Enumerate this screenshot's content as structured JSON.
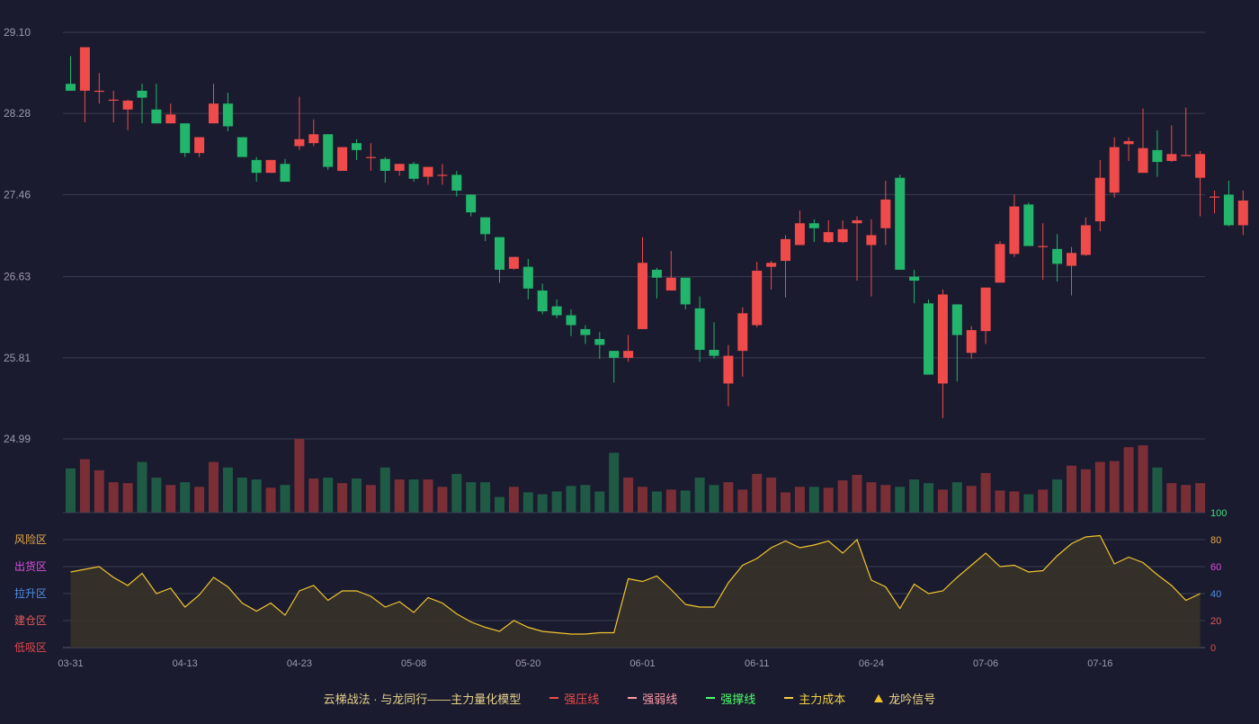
{
  "chart_data": {
    "type": "candlestick",
    "price_axis": {
      "ticks": [
        "29.10",
        "28.28",
        "27.46",
        "26.63",
        "25.81",
        "24.99"
      ],
      "ylim": [
        24.99,
        29.1
      ]
    },
    "x_axis": {
      "ticks": [
        {
          "label": "03-31",
          "index": 0
        },
        {
          "label": "04-13",
          "index": 8
        },
        {
          "label": "04-23",
          "index": 16
        },
        {
          "label": "05-08",
          "index": 24
        },
        {
          "label": "05-20",
          "index": 32
        },
        {
          "label": "06-01",
          "index": 40
        },
        {
          "label": "06-11",
          "index": 48
        },
        {
          "label": "06-24",
          "index": 56
        },
        {
          "label": "07-06",
          "index": 64
        },
        {
          "label": "07-16",
          "index": 72
        }
      ]
    },
    "ohlc": [
      [
        28.58,
        28.51,
        28.86,
        28.51
      ],
      [
        28.51,
        28.95,
        28.95,
        28.19
      ],
      [
        28.51,
        28.51,
        28.69,
        28.38
      ],
      [
        28.41,
        28.42,
        28.51,
        28.19
      ],
      [
        28.32,
        28.41,
        28.42,
        28.11
      ],
      [
        28.51,
        28.44,
        28.58,
        28.18
      ],
      [
        28.32,
        28.18,
        28.58,
        28.18
      ],
      [
        28.18,
        28.27,
        28.38,
        28.18
      ],
      [
        28.18,
        27.88,
        28.18,
        27.84
      ],
      [
        27.88,
        28.04,
        28.04,
        27.84
      ],
      [
        28.18,
        28.38,
        28.58,
        28.18
      ],
      [
        28.38,
        28.15,
        28.49,
        28.1
      ],
      [
        28.04,
        27.84,
        28.04,
        27.84
      ],
      [
        27.81,
        27.68,
        27.84,
        27.59
      ],
      [
        27.68,
        27.81,
        27.81,
        27.68
      ],
      [
        27.77,
        27.59,
        27.82,
        27.59
      ],
      [
        27.95,
        28.02,
        28.45,
        27.91
      ],
      [
        27.98,
        28.07,
        28.22,
        27.95
      ],
      [
        28.07,
        27.74,
        28.07,
        27.71
      ],
      [
        27.7,
        27.94,
        27.94,
        27.7
      ],
      [
        27.98,
        27.91,
        28.02,
        27.81
      ],
      [
        27.84,
        27.84,
        27.98,
        27.7
      ],
      [
        27.82,
        27.7,
        27.84,
        27.58
      ],
      [
        27.7,
        27.77,
        27.77,
        27.65
      ],
      [
        27.77,
        27.62,
        27.79,
        27.59
      ],
      [
        27.64,
        27.74,
        27.74,
        27.56
      ],
      [
        27.66,
        27.66,
        27.77,
        27.56
      ],
      [
        27.66,
        27.5,
        27.7,
        27.44
      ],
      [
        27.46,
        27.28,
        27.46,
        27.24
      ],
      [
        27.23,
        27.06,
        27.23,
        26.99
      ],
      [
        27.03,
        26.7,
        27.03,
        26.57
      ],
      [
        26.71,
        26.83,
        26.83,
        26.7
      ],
      [
        26.73,
        26.51,
        26.81,
        26.4
      ],
      [
        26.49,
        26.28,
        26.56,
        26.25
      ],
      [
        26.33,
        26.24,
        26.4,
        26.21
      ],
      [
        26.24,
        26.14,
        26.3,
        26.03
      ],
      [
        26.1,
        26.04,
        26.14,
        25.95
      ],
      [
        26.0,
        25.94,
        26.07,
        25.8
      ],
      [
        25.88,
        25.81,
        25.88,
        25.56
      ],
      [
        25.81,
        25.88,
        26.04,
        25.77
      ],
      [
        26.1,
        26.77,
        27.03,
        26.1
      ],
      [
        26.7,
        26.62,
        26.72,
        26.41
      ],
      [
        26.49,
        26.62,
        26.89,
        26.49
      ],
      [
        26.62,
        26.35,
        26.62,
        26.3
      ],
      [
        26.31,
        25.89,
        26.43,
        25.77
      ],
      [
        25.89,
        25.83,
        26.17,
        25.8
      ],
      [
        25.55,
        25.83,
        25.94,
        25.32
      ],
      [
        25.88,
        26.26,
        26.32,
        25.62
      ],
      [
        26.14,
        26.69,
        26.78,
        26.12
      ],
      [
        26.73,
        26.77,
        26.79,
        26.5
      ],
      [
        26.79,
        27.01,
        27.05,
        26.42
      ],
      [
        26.95,
        27.17,
        27.3,
        26.95
      ],
      [
        27.17,
        27.12,
        27.21,
        26.98
      ],
      [
        26.98,
        27.08,
        27.2,
        26.97
      ],
      [
        26.98,
        27.11,
        27.2,
        26.97
      ],
      [
        27.17,
        27.2,
        27.24,
        26.59
      ],
      [
        26.95,
        27.05,
        27.21,
        26.43
      ],
      [
        27.12,
        27.41,
        27.6,
        26.95
      ],
      [
        27.63,
        26.7,
        27.66,
        26.7
      ],
      [
        26.63,
        26.59,
        26.7,
        26.36
      ],
      [
        26.36,
        25.64,
        26.4,
        25.64
      ],
      [
        25.55,
        26.45,
        26.5,
        25.2
      ],
      [
        26.35,
        26.04,
        26.35,
        25.57
      ],
      [
        25.86,
        26.09,
        26.13,
        25.8
      ],
      [
        26.08,
        26.52,
        26.52,
        25.95
      ],
      [
        26.57,
        26.96,
        26.99,
        26.57
      ],
      [
        26.86,
        27.34,
        27.46,
        26.83
      ],
      [
        27.36,
        26.94,
        27.38,
        26.94
      ],
      [
        26.93,
        26.94,
        27.17,
        26.6
      ],
      [
        26.91,
        26.76,
        27.06,
        26.58
      ],
      [
        26.74,
        26.87,
        26.93,
        26.44
      ],
      [
        26.85,
        27.15,
        27.23,
        26.84
      ],
      [
        27.19,
        27.63,
        27.81,
        27.09
      ],
      [
        27.48,
        27.94,
        28.04,
        27.43
      ],
      [
        27.97,
        28.0,
        28.04,
        27.8
      ],
      [
        27.68,
        27.93,
        28.33,
        27.68
      ],
      [
        27.91,
        27.79,
        28.11,
        27.64
      ],
      [
        27.8,
        27.87,
        28.16,
        27.79
      ],
      [
        27.86,
        27.86,
        28.34,
        27.86
      ],
      [
        27.63,
        27.87,
        27.9,
        27.24
      ],
      [
        27.44,
        27.44,
        27.5,
        27.27
      ],
      [
        27.46,
        27.15,
        27.6,
        27.14
      ],
      [
        27.15,
        27.4,
        27.5,
        27.05
      ]
    ],
    "volume": [
      48,
      58,
      46,
      33,
      32,
      55,
      38,
      30,
      33,
      28,
      55,
      49,
      38,
      36,
      27,
      30,
      80,
      37,
      38,
      32,
      37,
      30,
      49,
      36,
      36,
      36,
      28,
      42,
      33,
      33,
      17,
      28,
      22,
      20,
      23,
      29,
      30,
      23,
      65,
      38,
      28,
      23,
      25,
      24,
      38,
      30,
      33,
      25,
      42,
      38,
      22,
      28,
      28,
      27,
      35,
      41,
      33,
      30,
      28,
      36,
      32,
      25,
      33,
      29,
      43,
      24,
      23,
      20,
      25,
      36,
      51,
      47,
      55,
      56,
      71,
      73,
      49,
      32,
      30,
      32
    ]
  },
  "indicator": {
    "zones": [
      "风险区",
      "出货区",
      "拉升区",
      "建仓区",
      "低吸区"
    ],
    "zone_colors": [
      "#e7a84a",
      "#d94fe0",
      "#4f8fe8",
      "#e05a5a",
      "#e0474c"
    ],
    "right_ticks": [
      "100",
      "80",
      "60",
      "40",
      "20",
      "0"
    ],
    "right_tick_colors": [
      "#3ee07a",
      "#e7a84a",
      "#d94fe0",
      "#4f8fe8",
      "#e05a5a",
      "#e0474c"
    ],
    "values": [
      56,
      58,
      60,
      52,
      46,
      55,
      40,
      44,
      30,
      39,
      52,
      45,
      33,
      27,
      33,
      24,
      42,
      46,
      35,
      42,
      42,
      38,
      30,
      34,
      26,
      37,
      33,
      25,
      19,
      15,
      12,
      20,
      15,
      12,
      11,
      10,
      10,
      11,
      11,
      51,
      49,
      53,
      43,
      32,
      30,
      30,
      48,
      61,
      66,
      74,
      79,
      74,
      76,
      79,
      70,
      80,
      50,
      45,
      29,
      47,
      40,
      42,
      52,
      61,
      70,
      60,
      61,
      56,
      57,
      68,
      77,
      82,
      83,
      62,
      67,
      63,
      54,
      46,
      35,
      40
    ]
  },
  "legend": {
    "title": "云梯战法 · 与龙同行——主力量化模型",
    "items": [
      {
        "label": "强压线",
        "style": "solid",
        "color": "#ef4b4b"
      },
      {
        "label": "强弱线",
        "style": "dash",
        "color": "#ff9aa8"
      },
      {
        "label": "强撑线",
        "style": "solid",
        "color": "#4dff6a"
      },
      {
        "label": "主力成本",
        "style": "dash",
        "color": "#f3d044"
      },
      {
        "label": "龙吟信号",
        "style": "triangle",
        "color": "#f0c030"
      }
    ]
  },
  "colors": {
    "up": "#ef4b4b",
    "down": "#22b56b",
    "vol_up": "#7a2f36",
    "vol_down": "#1f5a45",
    "grid": "#3a3c52",
    "axis_text": "#9a9aab",
    "indicator_line": "#f0c530",
    "indicator_fill": "#3a3328"
  }
}
